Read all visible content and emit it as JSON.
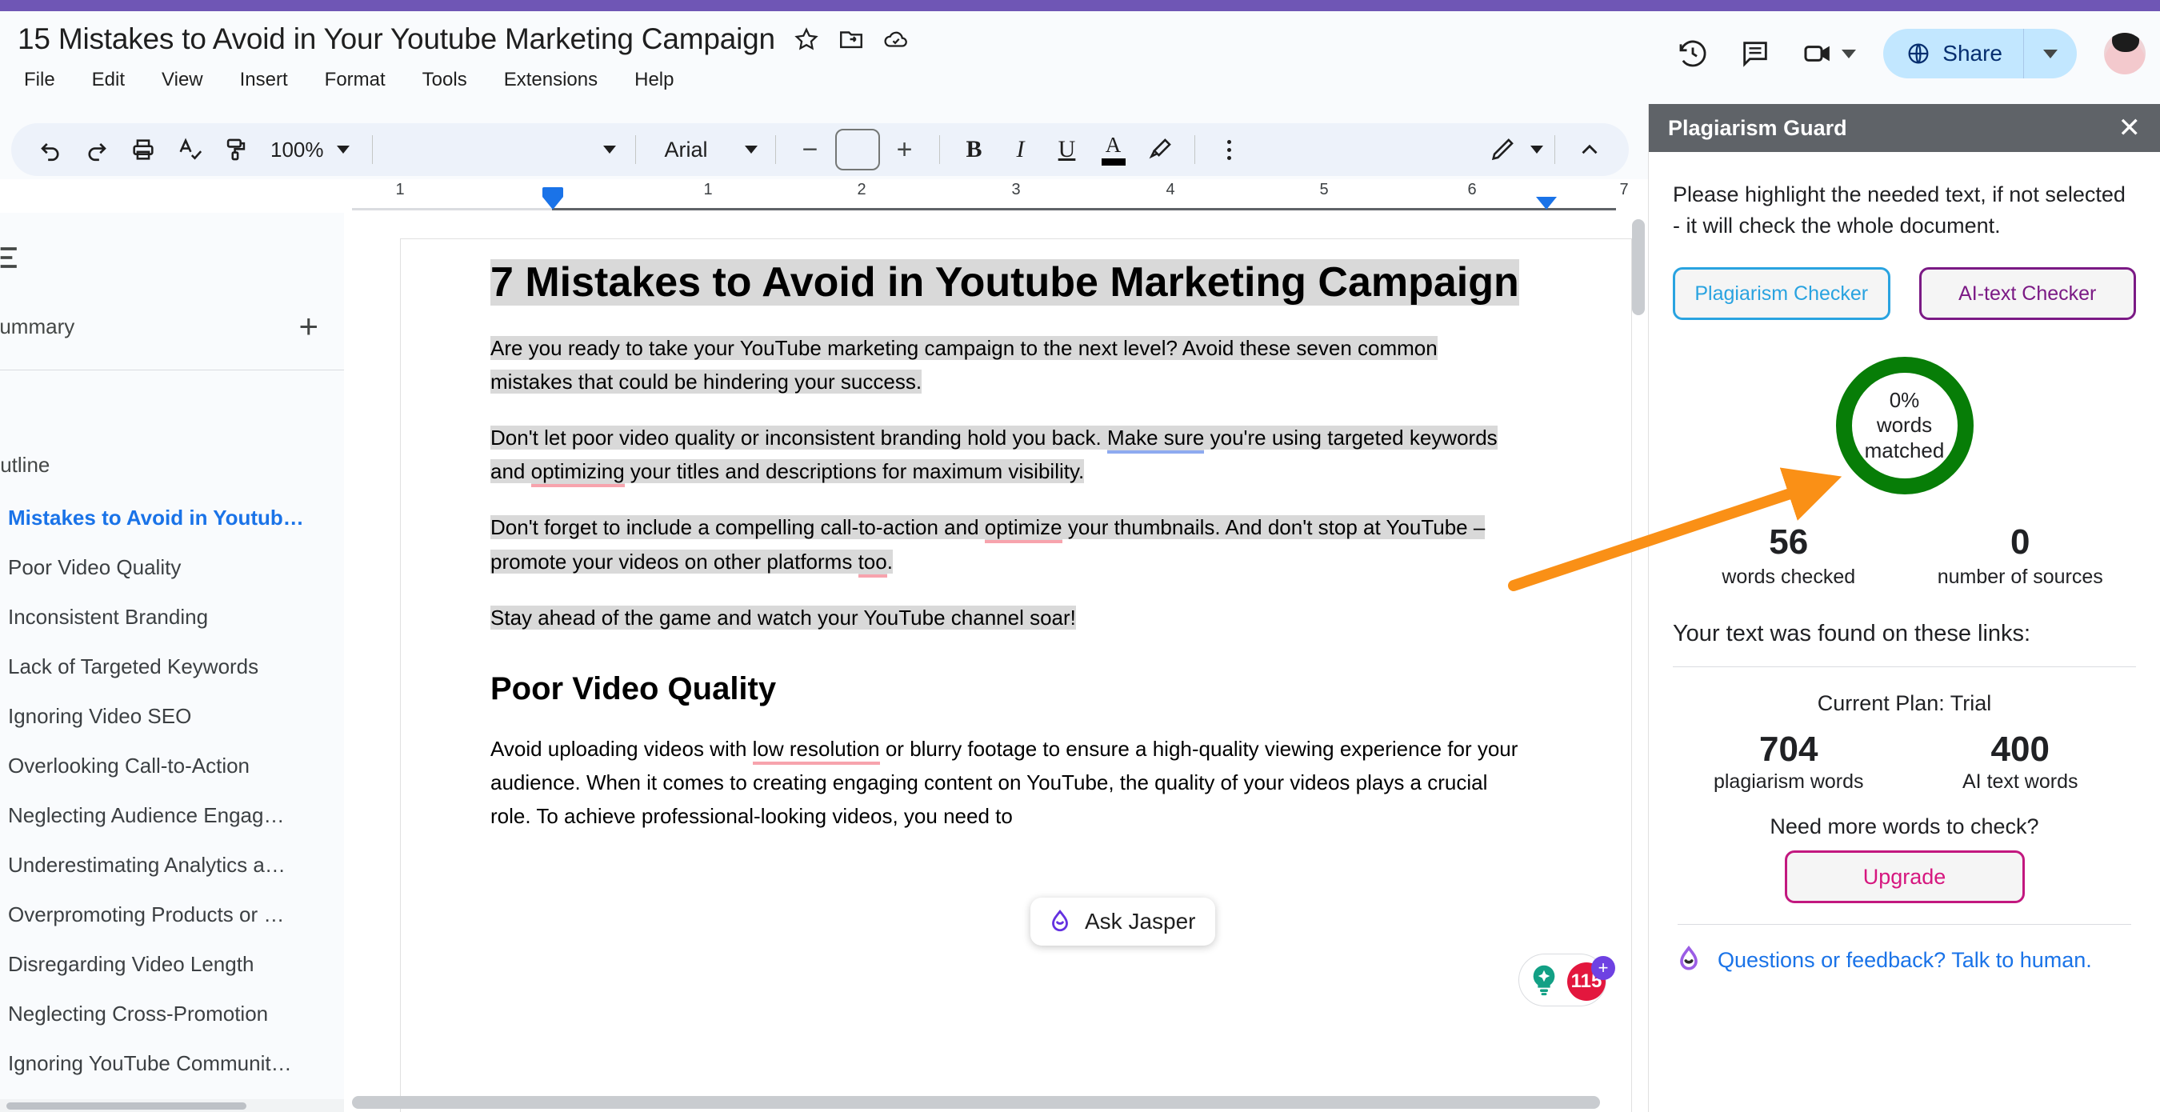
{
  "header": {
    "doc_title": "15 Mistakes to Avoid in Your Youtube Marketing Campaign",
    "icons": {
      "star": "star-icon",
      "move": "move-to-folder-icon",
      "cloud": "saved-to-drive-icon"
    },
    "menu": [
      "File",
      "Edit",
      "View",
      "Insert",
      "Format",
      "Tools",
      "Extensions",
      "Help"
    ],
    "right": {
      "history_icon": "version-history-icon",
      "comment_icon": "comment-icon",
      "meet_icon": "google-meet-icon",
      "share_label": "Share"
    }
  },
  "toolbar": {
    "zoom": "100%",
    "style_value": "",
    "font": "Arial",
    "font_size": "",
    "minus": "−",
    "plus": "+",
    "bold": "B",
    "italic": "I",
    "underline": "U",
    "text_color": "A"
  },
  "ruler": {
    "numbers": [
      "1",
      "1",
      "2",
      "3",
      "4",
      "5",
      "6",
      "7"
    ]
  },
  "sidebar": {
    "summary_label": "Summary",
    "add_summary": "+",
    "outline_label": "Outline",
    "items": [
      {
        "label": "Mistakes to Avoid in Youtub…",
        "active": true
      },
      {
        "label": "Poor Video Quality",
        "active": false
      },
      {
        "label": "Inconsistent Branding",
        "active": false
      },
      {
        "label": "Lack of Targeted Keywords",
        "active": false
      },
      {
        "label": "Ignoring Video SEO",
        "active": false
      },
      {
        "label": "Overlooking Call-to-Action",
        "active": false
      },
      {
        "label": "Neglecting Audience Engag…",
        "active": false
      },
      {
        "label": "Underestimating Analytics a…",
        "active": false
      },
      {
        "label": "Overpromoting Products or …",
        "active": false
      },
      {
        "label": "Disregarding Video Length",
        "active": false
      },
      {
        "label": "Neglecting Cross-Promotion",
        "active": false
      },
      {
        "label": "Ignoring YouTube Communit…",
        "active": false
      }
    ]
  },
  "document": {
    "heading": "7 Mistakes to Avoid in Youtube Marketing Campaign",
    "p1": "Are you ready to take your YouTube marketing campaign to the next level? Avoid these seven common mistakes that could be hindering your success.",
    "p2_a": "Don't let poor video quality or inconsistent branding hold you back. ",
    "p2_blue": "Make sure",
    "p2_b": " you're using targeted keywords and ",
    "p2_red": "optimizing",
    "p2_c": " your titles and descriptions for maximum visibility.",
    "p3_a": "Don't forget to include a compelling call-to-action and ",
    "p3_red": "optimize",
    "p3_b": " your thumbnails. And don't stop at YouTube – promote your videos on other platforms ",
    "p3_red2": "too",
    "p3_c": ".",
    "p4": "Stay ahead of the game and watch your YouTube channel soar!",
    "h2": "Poor Video Quality",
    "p5_a": "Avoid uploading videos with ",
    "p5_red": "low resolution",
    "p5_b": " or blurry footage to ensure a high-quality viewing experience for your audience. When it comes to creating engaging content on YouTube, the quality of your videos plays a crucial role. To achieve professional-looking videos, you need to"
  },
  "ask_jasper": {
    "label": "Ask Jasper",
    "icon": "jasper-drop-icon"
  },
  "explore_badge": {
    "count": "115",
    "plus": "+",
    "icon": "lightbulb-icon"
  },
  "panel": {
    "title": "Plagiarism Guard",
    "close": "✕",
    "note": "Please highlight the needed text, if not selected - it will check the whole document.",
    "buttons": {
      "plagiarism": "Plagiarism Checker",
      "ai": "AI-text Checker"
    },
    "ring": {
      "percent": "0%",
      "line2": "words",
      "line3": "matched",
      "color": "#077d07"
    },
    "stats": [
      {
        "num": "56",
        "label": "words checked"
      },
      {
        "num": "0",
        "label": "number of sources"
      }
    ],
    "links_title": "Your text was found on these links:",
    "plan": "Current Plan: Trial",
    "quota": [
      {
        "num": "704",
        "label": "plagiarism words"
      },
      {
        "num": "400",
        "label": "AI text words"
      }
    ],
    "need_more": "Need more words to check?",
    "upgrade": "Upgrade",
    "talk": "Questions or feedback? Talk to human."
  },
  "annotation": {
    "arrow_color": "#fa9016"
  }
}
